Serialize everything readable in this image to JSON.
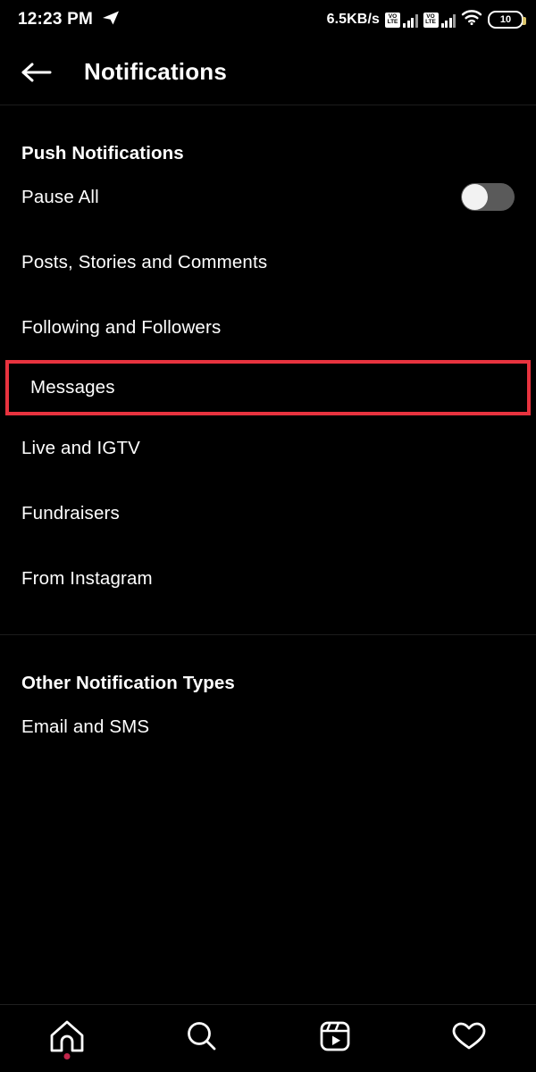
{
  "status_bar": {
    "time": "12:23 PM",
    "app_icon": "telegram-paper-plane-icon",
    "network_speed": "6.5KB/s",
    "volte_label_top": "VO",
    "volte_label_bottom": "LTE",
    "sim1_signal": "volte-signal-icon",
    "sim2_signal": "volte-signal-icon",
    "wifi": "wifi-icon",
    "battery_percent": "10"
  },
  "header": {
    "back_icon": "back-arrow-icon",
    "title": "Notifications"
  },
  "sections": [
    {
      "title": "Push Notifications",
      "rows": [
        {
          "label": "Pause All",
          "control": "toggle",
          "toggle_on": false
        },
        {
          "label": "Posts, Stories and Comments",
          "control": "none"
        },
        {
          "label": "Following and Followers",
          "control": "none"
        },
        {
          "label": "Messages",
          "control": "none",
          "highlighted": true
        },
        {
          "label": "Live and IGTV",
          "control": "none"
        },
        {
          "label": "Fundraisers",
          "control": "none"
        },
        {
          "label": "From Instagram",
          "control": "none"
        }
      ]
    },
    {
      "title": "Other Notification Types",
      "rows": [
        {
          "label": "Email and SMS",
          "control": "none"
        }
      ]
    }
  ],
  "bottom_nav": [
    {
      "icon": "home-icon",
      "badge": true
    },
    {
      "icon": "search-icon",
      "badge": false
    },
    {
      "icon": "reels-icon",
      "badge": false
    },
    {
      "icon": "heart-icon",
      "badge": false
    }
  ],
  "colors": {
    "background": "#000000",
    "text": "#ffffff",
    "highlight_border": "#e8333f",
    "divider": "#1c1c1c",
    "toggle_track": "#5a5a5a",
    "toggle_knob": "#f2f2f2",
    "badge_dot": "#c2264b"
  }
}
